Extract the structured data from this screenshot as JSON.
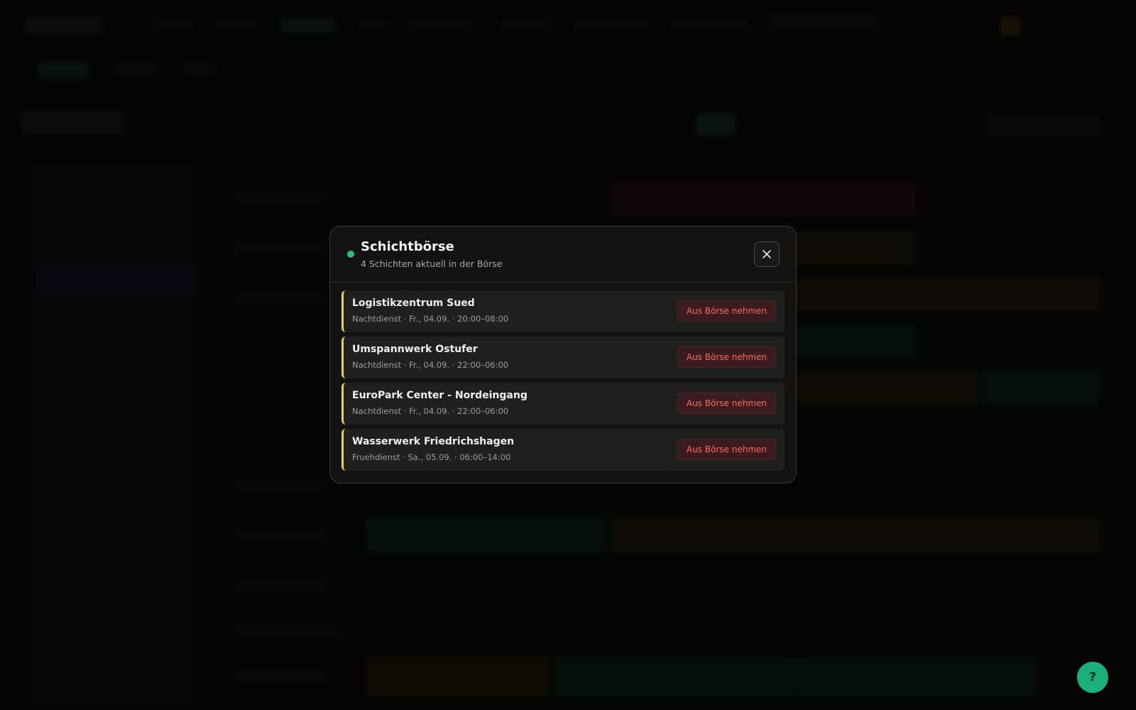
{
  "modal": {
    "title": "Schichtbörse",
    "subtitle": "4 Schichten aktuell in der Börse",
    "status_color": "#22c27a",
    "shifts": [
      {
        "name": "Logistikzentrum Sued",
        "meta": "Nachtdienst · Fr., 04.09. · 20:00–08:00",
        "action": "Aus Börse nehmen"
      },
      {
        "name": "Umspannwerk Ostufer",
        "meta": "Nachtdienst · Fr., 04.09. · 22:00–06:00",
        "action": "Aus Börse nehmen"
      },
      {
        "name": "EuroPark Center - Nordeingang",
        "meta": "Nachtdienst · Fr., 04.09. · 22:00–06:00",
        "action": "Aus Börse nehmen"
      },
      {
        "name": "Wasserwerk Friedrichshagen",
        "meta": "Fruehdienst · Sa., 05.09. · 06:00–14:00",
        "action": "Aus Börse nehmen"
      }
    ]
  },
  "help": {
    "label": "?"
  },
  "icons": {
    "close": "close-icon",
    "help": "question-icon"
  },
  "colors": {
    "accent": "#19b07a",
    "shift_border": "#e8d24a",
    "danger_text": "#ff6a5e"
  }
}
